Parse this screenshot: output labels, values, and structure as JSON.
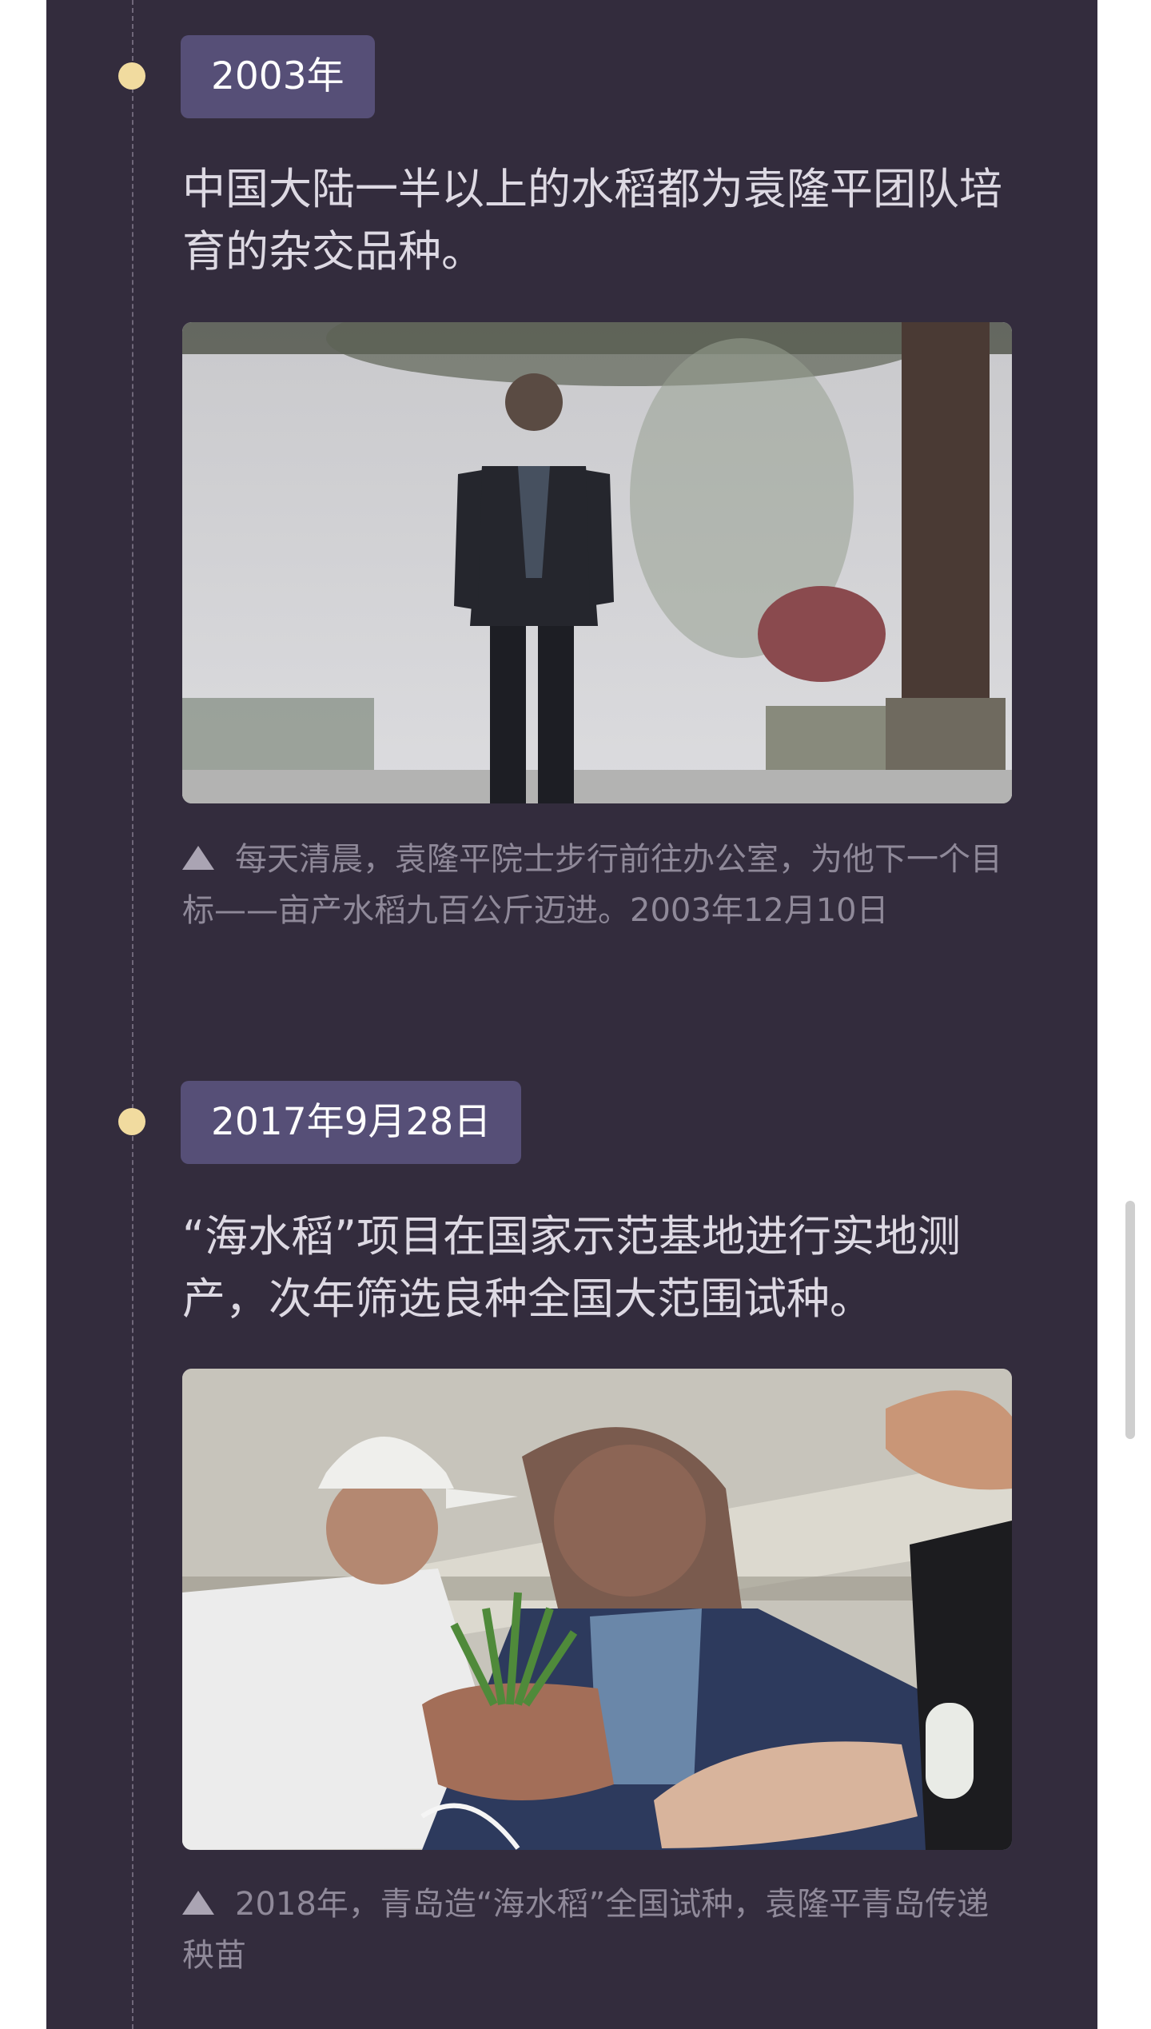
{
  "entries": [
    {
      "date": "2003年",
      "headline": "中国大陆一半以上的水稻都为袁隆平团队培育的杂交品种。",
      "photo_icon": "photo-walking-morning",
      "caption_icon": "triangle-up-icon",
      "caption": "每天清晨，袁隆平院士步行前往办公室，为他下一个目标——亩产水稻九百公斤迈进。2003年12月10日"
    },
    {
      "date": "2017年9月28日",
      "headline": "“海水稻”项目在国家示范基地进行实地测产，次年筛选良种全国大范围试种。",
      "photo_icon": "photo-rice-seedlings",
      "caption_icon": "triangle-up-icon",
      "caption": "2018年，青岛造“海水稻”全国试种，袁隆平青岛传递秧苗"
    }
  ],
  "colors": {
    "panel_background": "#332c3d",
    "dot": "#f1db9f",
    "date_tag": "#564f77",
    "headline_text": "#ddd9e3",
    "caption_text": "#8f8999"
  }
}
